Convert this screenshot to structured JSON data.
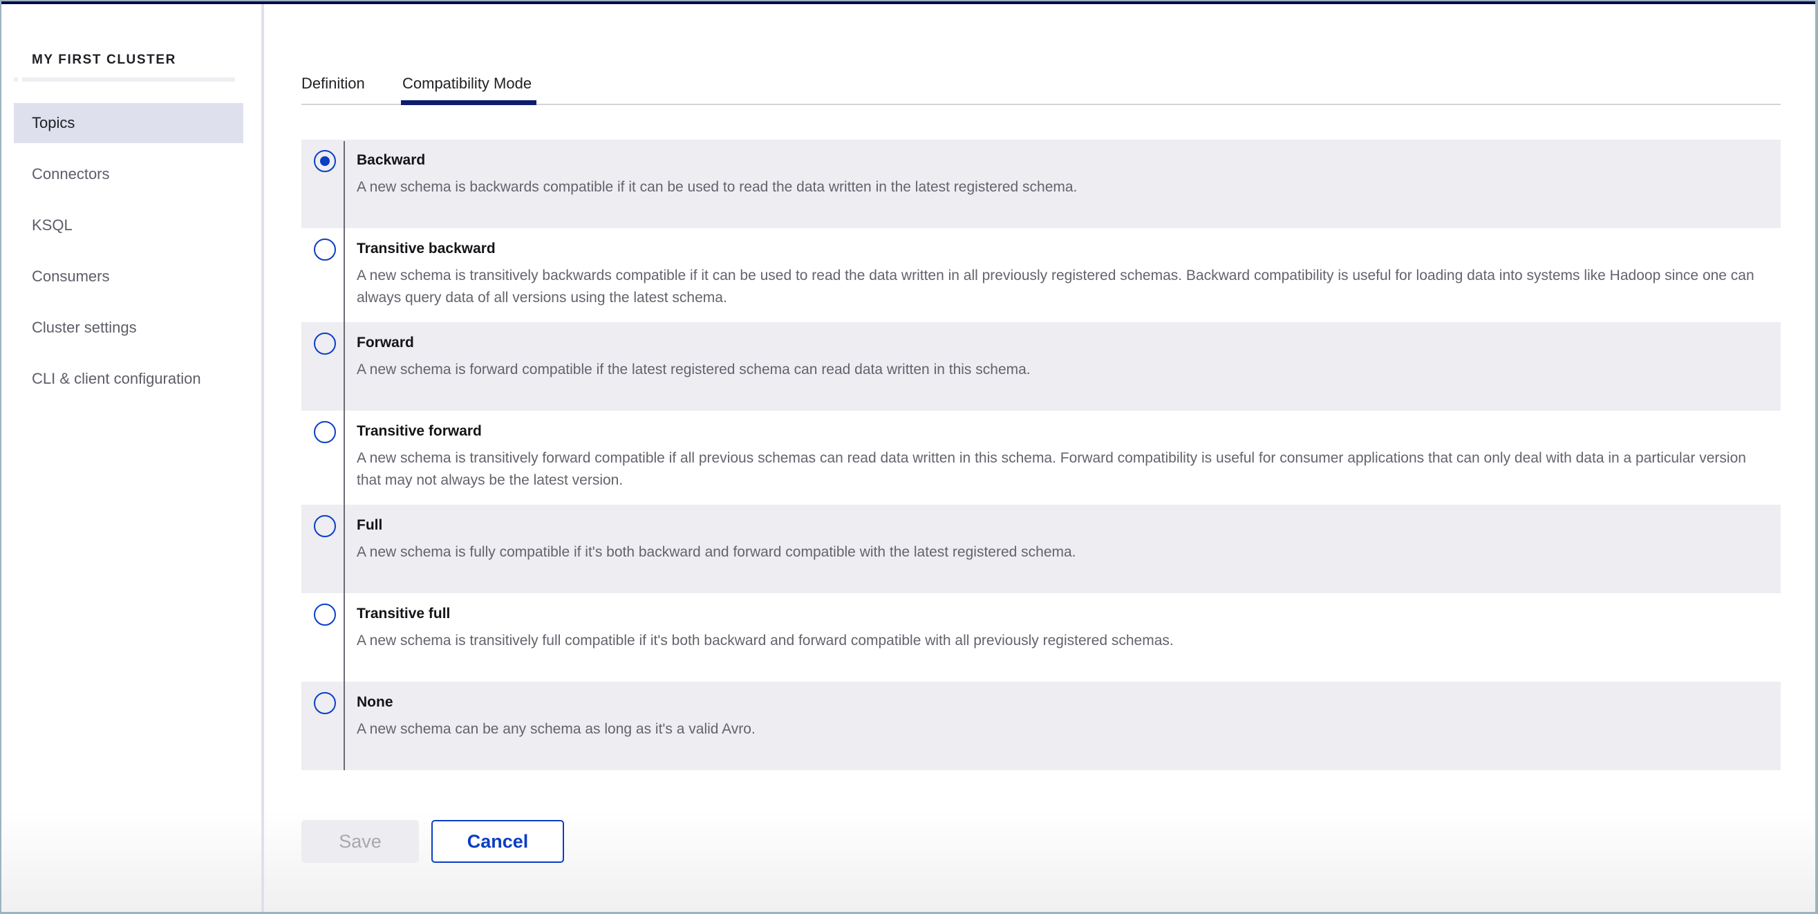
{
  "window": {
    "topbar_color": "#060b4d"
  },
  "sidebar": {
    "cluster_title": "MY FIRST CLUSTER",
    "items": [
      {
        "label": "Topics",
        "active": true
      },
      {
        "label": "Connectors",
        "active": false
      },
      {
        "label": "KSQL",
        "active": false
      },
      {
        "label": "Consumers",
        "active": false
      },
      {
        "label": "Cluster settings",
        "active": false
      },
      {
        "label": "CLI & client configuration",
        "active": false
      }
    ]
  },
  "tabs": [
    {
      "label": "Definition",
      "active": false
    },
    {
      "label": "Compatibility Mode",
      "active": true
    }
  ],
  "compatibility": {
    "selected": "Backward",
    "options": [
      {
        "title": "Backward",
        "checked": true,
        "description": "A new schema is backwards compatible if it can be used to read the data written in the latest registered schema."
      },
      {
        "title": "Transitive backward",
        "checked": false,
        "description": "A new schema is transitively backwards compatible if it can be used to read the data written in all previously registered schemas. Backward compatibility is useful for loading data into systems like Hadoop since one can always query data of all versions using the latest schema."
      },
      {
        "title": "Forward",
        "checked": false,
        "description": "A new schema is forward compatible if the latest registered schema can read data written in this schema."
      },
      {
        "title": "Transitive forward",
        "checked": false,
        "description": "A new schema is transitively forward compatible if all previous schemas can read data written in this schema. Forward compatibility is useful for consumer applications that can only deal with data in a particular version that may not always be the latest version."
      },
      {
        "title": "Full",
        "checked": false,
        "description": "A new schema is fully compatible if it's both backward and forward compatible with the latest registered schema."
      },
      {
        "title": "Transitive full",
        "checked": false,
        "description": "A new schema is transitively full compatible if it's both backward and forward compatible with all previously registered schemas."
      },
      {
        "title": "None",
        "checked": false,
        "description": "A new schema can be any schema as long as it's a valid Avro."
      }
    ]
  },
  "actions": {
    "save_label": "Save",
    "save_disabled": true,
    "cancel_label": "Cancel"
  },
  "colors": {
    "accent": "#0b3ec4",
    "active_tab_underline": "#0f1b6e",
    "sidebar_active_bg": "#dfe0ee",
    "option_shaded_bg": "#ededf2"
  }
}
